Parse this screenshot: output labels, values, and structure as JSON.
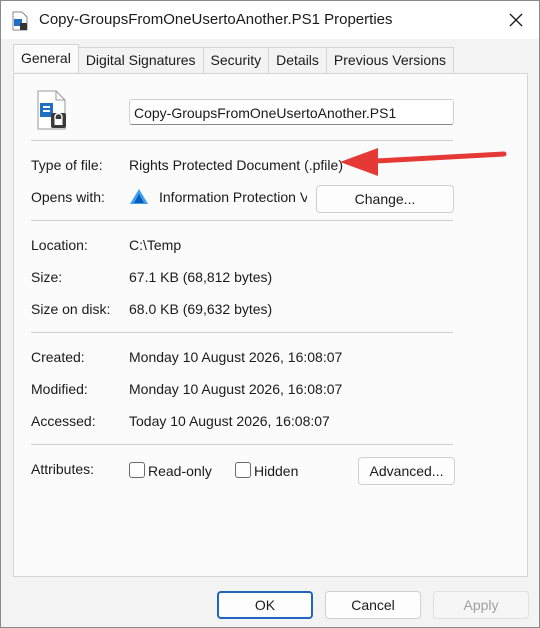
{
  "window": {
    "title": "Copy-GroupsFromOneUsertoAnother.PS1 Properties",
    "close_icon": "close-icon"
  },
  "tabs": [
    {
      "label": "General"
    },
    {
      "label": "Digital Signatures"
    },
    {
      "label": "Security"
    },
    {
      "label": "Details"
    },
    {
      "label": "Previous Versions"
    }
  ],
  "general": {
    "file_name": "Copy-GroupsFromOneUsertoAnother.PS1",
    "type_label": "Type of file:",
    "type_value": "Rights Protected Document (.pfile)",
    "opens_label": "Opens with:",
    "opens_value": "Information Protection Vie",
    "change_button": "Change...",
    "location_label": "Location:",
    "location_value": "C:\\Temp",
    "size_label": "Size:",
    "size_value": "67.1 KB (68,812 bytes)",
    "size_disk_label": "Size on disk:",
    "size_disk_value": "68.0 KB (69,632 bytes)",
    "created_label": "Created:",
    "created_value": "Monday 10 August 2026, 16:08:07",
    "modified_label": "Modified:",
    "modified_value": "Monday 10 August 2026, 16:08:07",
    "accessed_label": "Accessed:",
    "accessed_value": "Today 10 August 2026, 16:08:07",
    "attributes_label": "Attributes:",
    "readonly_label": "Read-only",
    "hidden_label": "Hidden",
    "advanced_button": "Advanced..."
  },
  "footer": {
    "ok": "OK",
    "cancel": "Cancel",
    "apply": "Apply"
  },
  "colors": {
    "arrow": "#e53935",
    "ok_border": "#1e66c0"
  }
}
